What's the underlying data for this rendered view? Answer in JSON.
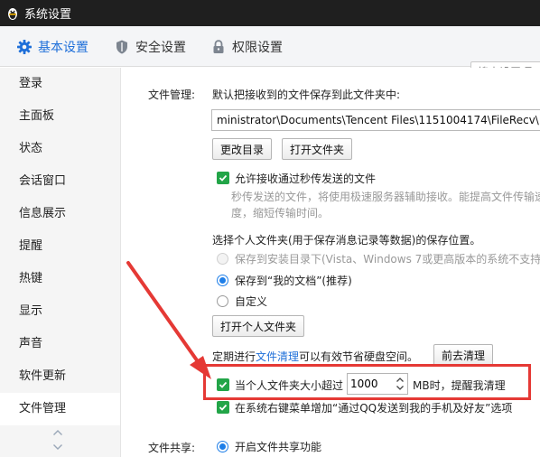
{
  "window": {
    "title": "系统设置"
  },
  "tabs": [
    {
      "label": "基本设置",
      "icon": "gear-icon"
    },
    {
      "label": "安全设置",
      "icon": "shield-icon"
    },
    {
      "label": "权限设置",
      "icon": "lock-icon"
    }
  ],
  "search": {
    "placeholder": "搜索设置项"
  },
  "sidebar": {
    "items": [
      "登录",
      "主面板",
      "状态",
      "会话窗口",
      "信息展示",
      "提醒",
      "热键",
      "显示",
      "声音",
      "软件更新",
      "文件管理"
    ],
    "active": "文件管理"
  },
  "file_management": {
    "section_label": "文件管理:",
    "save_to_label": "默认把接收到的文件保存到此文件夹中:",
    "path_value": "ministrator\\Documents\\Tencent Files\\1151004174\\FileRecv\\",
    "change_dir_button": "更改目录",
    "open_folder_button": "打开文件夹",
    "allow_fast_label": "允许接收通过秒传发送的文件",
    "fast_desc_line1": "秒传发送的文件，将使用极速服务器辅助接收。能提高文件传输速",
    "fast_desc_line2": "度，缩短传输时间。",
    "personal_folder_label": "选择个人文件夹(用于保存消息记录等数据)的保存位置。",
    "radio_install_dir": "保存到安装目录下(Vista、Windows 7或更高版本的系统不支持)",
    "radio_my_docs": "保存到“我的文档”(推荐)",
    "radio_custom": "自定义",
    "open_personal_button": "打开个人文件夹",
    "cleanup_prefix": "定期进行",
    "cleanup_link": "文件清理",
    "cleanup_suffix": "可以有效节省硬盘空间。",
    "go_cleanup_button": "前去清理",
    "size_remind_prefix": "当个人文件夹大小超过",
    "size_value": "1000",
    "size_remind_suffix": "MB时，提醒我清理",
    "context_menu_label": "在系统右键菜单增加“通过QQ发送到我的手机及好友”选项"
  },
  "file_sharing": {
    "section_label": "文件共享:",
    "enable_label": "开启文件共享功能"
  },
  "colors": {
    "accent": "#1e6fd9",
    "checkbox": "#22a548",
    "annotation": "#e53935"
  }
}
